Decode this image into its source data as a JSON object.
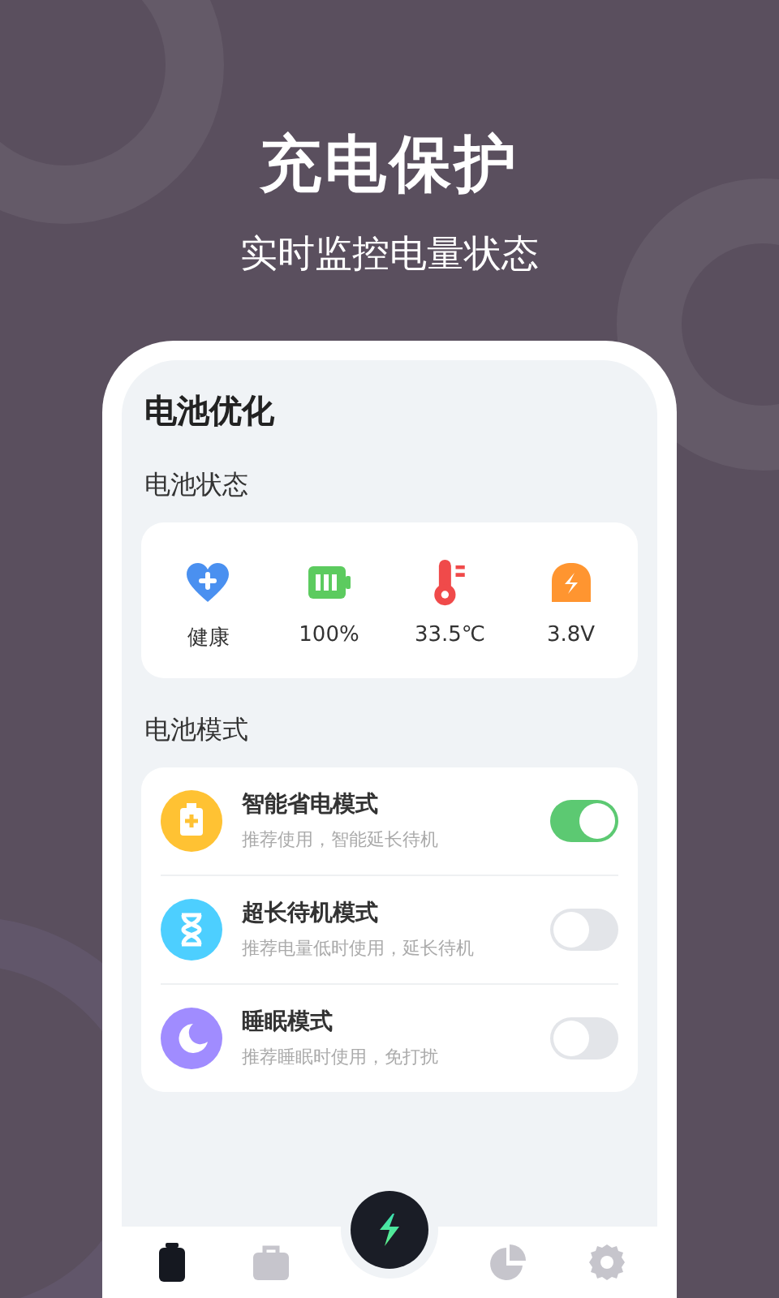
{
  "headline": "充电保护",
  "subheadline": "实时监控电量状态",
  "screen": {
    "title": "电池优化",
    "status_section": {
      "title": "电池状态",
      "items": [
        {
          "kind": "health",
          "label": "健康"
        },
        {
          "kind": "battery",
          "label": "100%"
        },
        {
          "kind": "temperature",
          "label": "33.5℃"
        },
        {
          "kind": "voltage",
          "label": "3.8V"
        }
      ]
    },
    "mode_section": {
      "title": "电池模式",
      "items": [
        {
          "kind": "saver",
          "color": "#ffc233",
          "title": "智能省电模式",
          "subtitle": "推荐使用，智能延长待机",
          "on": true
        },
        {
          "kind": "standby",
          "color": "#4dcfff",
          "title": "超长待机模式",
          "subtitle": "推荐电量低时使用，延长待机",
          "on": false
        },
        {
          "kind": "sleep",
          "color": "#a08cff",
          "title": "睡眠模式",
          "subtitle": "推荐睡眠时使用，免打扰",
          "on": false
        }
      ]
    },
    "nav": {
      "items": [
        {
          "kind": "battery",
          "selected": true
        },
        {
          "kind": "toolbox",
          "selected": false
        },
        {
          "kind": "bolt",
          "selected": false
        },
        {
          "kind": "pie",
          "selected": false
        },
        {
          "kind": "gear",
          "selected": false
        }
      ]
    }
  }
}
